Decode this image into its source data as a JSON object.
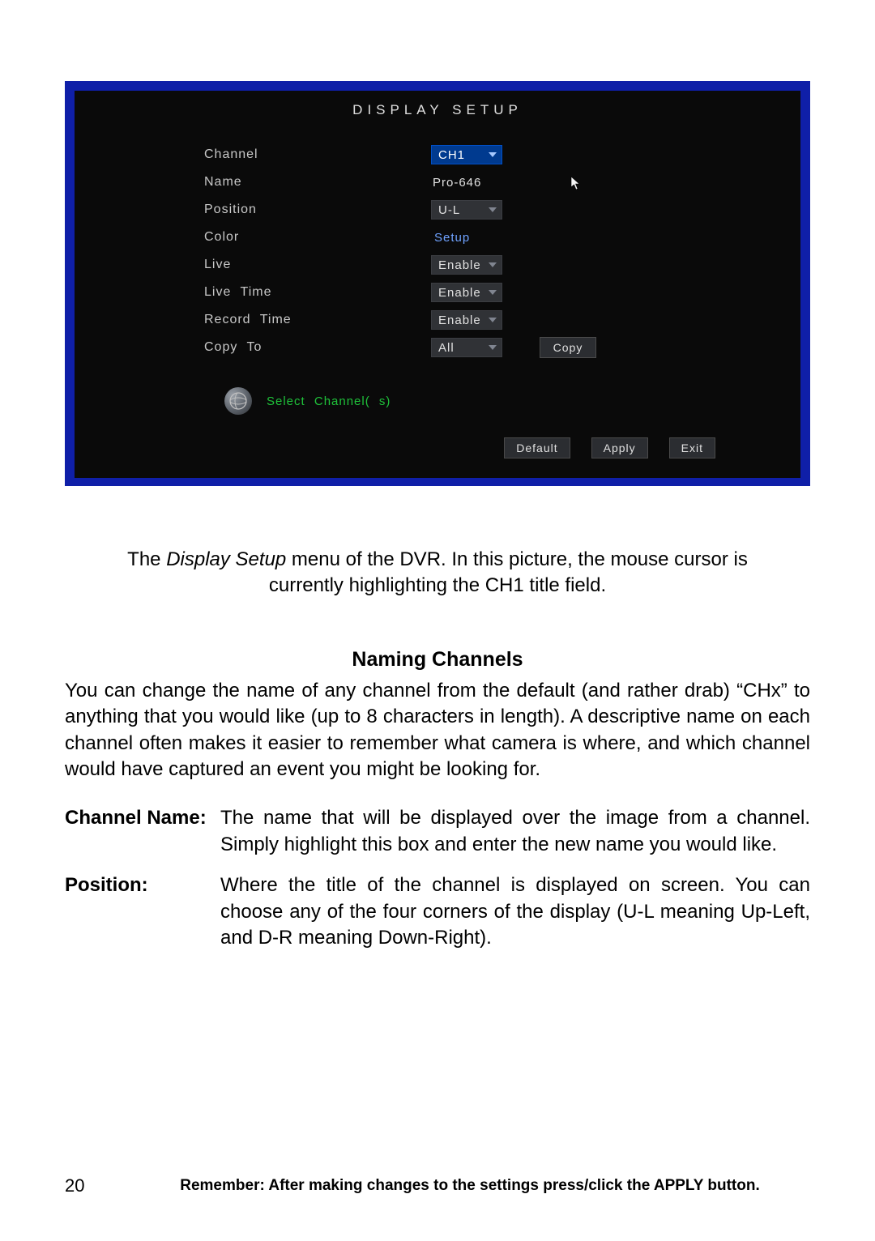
{
  "screenshot": {
    "title": "DISPLAY SETUP",
    "rows": {
      "channel": {
        "label": "Channel",
        "value": "CH1"
      },
      "name": {
        "label": "Name",
        "value": "Pro-646"
      },
      "position": {
        "label": "Position",
        "value": "U-L"
      },
      "color": {
        "label": "Color",
        "value": "Setup"
      },
      "live": {
        "label": "Live",
        "value": "Enable"
      },
      "live_time": {
        "label": "Live  Time",
        "value": "Enable"
      },
      "record_time": {
        "label": "Record  Time",
        "value": "Enable"
      },
      "copy_to": {
        "label": "Copy  To",
        "value": "All",
        "button": "Copy"
      }
    },
    "hint": "Select  Channel( s)",
    "buttons": {
      "default": "Default",
      "apply": "Apply",
      "exit": "Exit"
    }
  },
  "caption_pre": "The ",
  "caption_em": "Display Setup",
  "caption_post": " menu of the DVR. In this picture, the mouse cursor is currently highlighting the CH1 title field.",
  "heading": "Naming Channels",
  "paragraph": "You can change the name of any channel from the default (and rather drab) “CHx” to anything that you would like (up to 8 characters in length). A descriptive name on each channel often makes it easier to remember what camera is where, and which channel would have captured an event you might be looking for.",
  "defs": {
    "channel_name": {
      "term": "Channel Name:",
      "text": "The name that will be displayed over the image from a channel. Simply highlight this box and enter the new name you would like."
    },
    "position": {
      "term": "Position:",
      "text": "Where the title of the channel is displayed on screen. You can choose any of the four corners of the display (U-L meaning Up-Left, and D-R meaning Down-Right)."
    }
  },
  "page_number": "20",
  "footer_reminder": "Remember: After making changes to the settings press/click the APPLY button."
}
